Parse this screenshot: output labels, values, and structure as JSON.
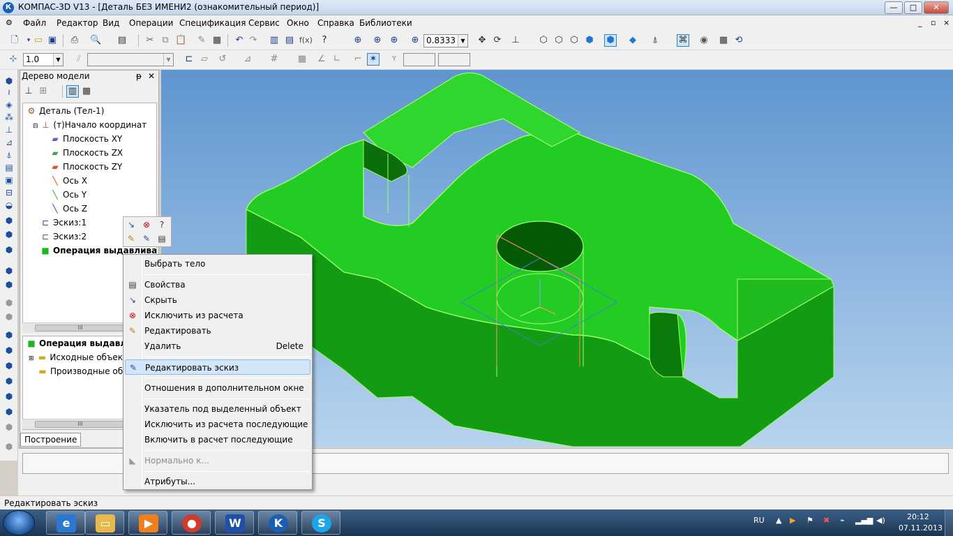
{
  "window": {
    "title": "КОМПАС-3D V13 - [Деталь БЕЗ ИМЕНИ2 (ознакомительный период)]",
    "app_icon": "К",
    "controls": {
      "minimize": "—",
      "maximize": "□",
      "close": "✕"
    }
  },
  "menubar": {
    "items": [
      "Файл",
      "Редактор",
      "Вид",
      "Операции",
      "Спецификация",
      "Сервис",
      "Окно",
      "Справка",
      "Библиотеки"
    ],
    "mdi_controls": [
      "_",
      "▫",
      "×"
    ]
  },
  "toolbar1": {
    "zoom_value": "0.8333"
  },
  "toolbar2": {
    "line_width_value": "1.0",
    "style_value": ""
  },
  "model_tree": {
    "title": "Дерево модели",
    "pin": "ᵽ",
    "close": "✕",
    "nodes": [
      {
        "label": "Деталь (Тел-1)",
        "icon": "part-icon",
        "glyph": "⚙",
        "color": "#a0522d"
      },
      {
        "label": "(т)Начало координат",
        "icon": "origin-icon",
        "glyph": "⊥",
        "color": "#b05020"
      },
      {
        "label": "Плоскость XY",
        "icon": "plane-xy-icon",
        "glyph": "▰",
        "color": "#6b5cc7"
      },
      {
        "label": "Плоскость ZX",
        "icon": "plane-zx-icon",
        "glyph": "▰",
        "color": "#3ea848"
      },
      {
        "label": "Плоскость ZY",
        "icon": "plane-zy-icon",
        "glyph": "▰",
        "color": "#e0502a"
      },
      {
        "label": "Ось X",
        "icon": "axis-x-icon",
        "glyph": "╲",
        "color": "#e04a10"
      },
      {
        "label": "Ось Y",
        "icon": "axis-y-icon",
        "glyph": "╲",
        "color": "#30a030"
      },
      {
        "label": "Ось Z",
        "icon": "axis-z-icon",
        "glyph": "╲",
        "color": "#6030c0"
      },
      {
        "label": "Эскиз:1",
        "icon": "sketch-icon",
        "glyph": "⊏",
        "color": "#1e4f9a"
      },
      {
        "label": "Эскиз:2",
        "icon": "sketch-icon",
        "glyph": "⊏",
        "color": "#555555"
      },
      {
        "label": "Операция выдавливан",
        "icon": "extrude-icon",
        "glyph": "■",
        "color": "#1eb61e"
      }
    ],
    "relations": {
      "root": "Операция выдавлив",
      "children": [
        "Исходные объект",
        "Производные об"
      ]
    },
    "scroll_thumb": "III",
    "tab": "Построение"
  },
  "context_menu": {
    "items": [
      {
        "label": "Выбрать тело",
        "icon": "",
        "shortcut": ""
      },
      {
        "label": "Свойства",
        "icon": "properties-icon",
        "shortcut": ""
      },
      {
        "label": "Скрыть",
        "icon": "hide-icon",
        "shortcut": ""
      },
      {
        "label": "Исключить из расчета",
        "icon": "exclude-icon",
        "shortcut": ""
      },
      {
        "label": "Редактировать",
        "icon": "edit-icon",
        "shortcut": ""
      },
      {
        "label": "Удалить",
        "icon": "",
        "shortcut": "Delete"
      },
      {
        "label": "Редактировать эскиз",
        "icon": "edit-sketch-icon",
        "shortcut": ""
      },
      {
        "label": "Отношения в дополнительном окне",
        "icon": "",
        "shortcut": ""
      },
      {
        "label": "Указатель под выделенный объект",
        "icon": "",
        "shortcut": ""
      },
      {
        "label": "Исключить из расчета последующие",
        "icon": "",
        "shortcut": ""
      },
      {
        "label": "Включить в расчет последующие",
        "icon": "",
        "shortcut": ""
      },
      {
        "label": "Нормально к...",
        "icon": "normal-to-icon",
        "shortcut": ""
      },
      {
        "label": "Атрибуты...",
        "icon": "",
        "shortcut": ""
      }
    ]
  },
  "statusbar": {
    "text": "Редактировать эскиз"
  },
  "taskbar": {
    "apps": [
      "file-explorer-icon",
      "internet-explorer-icon",
      "media-player-icon",
      "chrome-icon",
      "word-icon",
      "kompas-icon",
      "skype-icon"
    ],
    "lang": "RU",
    "time": "20:12",
    "date": "07.11.2013"
  },
  "colors": {
    "part_green": "#22cc22",
    "part_dark": "#128a12",
    "edge": "#9dff6a",
    "viewport_top": "#5f95d0",
    "highlight": "#d1e6f9"
  }
}
